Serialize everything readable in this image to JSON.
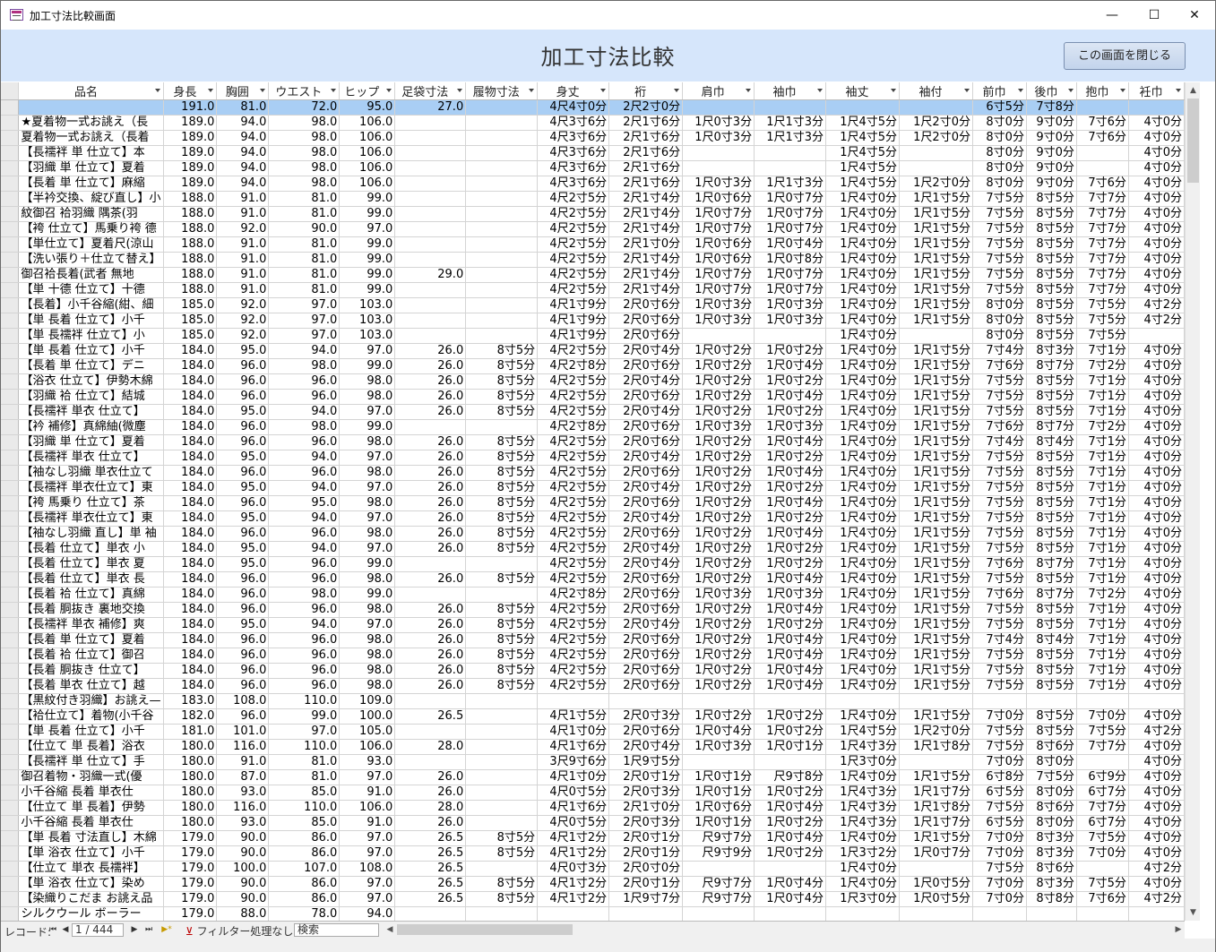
{
  "window": {
    "title": "加工寸法比較画面",
    "minimize_glyph": "—",
    "maximize_glyph": "☐",
    "close_glyph": "✕"
  },
  "header": {
    "caption": "加工寸法比較",
    "close_button_label": "この画面を閉じる"
  },
  "grid": {
    "columns": [
      "品名",
      "身長",
      "胸囲",
      "ウエスト",
      "ヒップ",
      "足袋寸法",
      "履物寸法",
      "身丈",
      "裄",
      "肩巾",
      "袖巾",
      "袖丈",
      "袖付",
      "前巾",
      "後巾",
      "抱巾",
      "衽巾"
    ],
    "sorted_column": "身長",
    "rows": [
      [
        "",
        "191.0",
        "81.0",
        "72.0",
        "95.0",
        "27.0",
        "",
        "4尺4寸0分",
        "2尺2寸0分",
        "",
        "",
        "",
        "",
        "6寸5分",
        "7寸8分",
        "",
        ""
      ],
      [
        "★夏着物一式お誂え（長",
        "189.0",
        "94.0",
        "98.0",
        "106.0",
        "",
        "",
        "4尺3寸6分",
        "2尺1寸6分",
        "1尺0寸3分",
        "1尺1寸3分",
        "1尺4寸5分",
        "1尺2寸0分",
        "8寸0分",
        "9寸0分",
        "7寸6分",
        "4寸0分"
      ],
      [
        "夏着物一式お誂え（長着",
        "189.0",
        "94.0",
        "98.0",
        "106.0",
        "",
        "",
        "4尺3寸6分",
        "2尺1寸6分",
        "1尺0寸3分",
        "1尺1寸3分",
        "1尺4寸5分",
        "1尺2寸0分",
        "8寸0分",
        "9寸0分",
        "7寸6分",
        "4寸0分"
      ],
      [
        "【長襦袢 単 仕立て】本",
        "189.0",
        "94.0",
        "98.0",
        "106.0",
        "",
        "",
        "4尺3寸6分",
        "2尺1寸6分",
        "",
        "",
        "1尺4寸5分",
        "",
        "8寸0分",
        "9寸0分",
        "",
        "4寸0分"
      ],
      [
        "【羽織 単 仕立て】夏着",
        "189.0",
        "94.0",
        "98.0",
        "106.0",
        "",
        "",
        "4尺3寸6分",
        "2尺1寸6分",
        "",
        "",
        "1尺4寸5分",
        "",
        "8寸0分",
        "9寸0分",
        "",
        "4寸0分"
      ],
      [
        "【長着 単 仕立て】麻縮",
        "189.0",
        "94.0",
        "98.0",
        "106.0",
        "",
        "",
        "4尺3寸6分",
        "2尺1寸6分",
        "1尺0寸3分",
        "1尺1寸3分",
        "1尺4寸5分",
        "1尺2寸0分",
        "8寸0分",
        "9寸0分",
        "7寸6分",
        "4寸0分"
      ],
      [
        "【半衿交換、綻び直し】小",
        "188.0",
        "91.0",
        "81.0",
        "99.0",
        "",
        "",
        "4尺2寸5分",
        "2尺1寸4分",
        "1尺0寸6分",
        "1尺0寸7分",
        "1尺4寸0分",
        "1尺1寸5分",
        "7寸5分",
        "8寸5分",
        "7寸7分",
        "4寸0分"
      ],
      [
        "紋御召 袷羽織 隅茶(羽",
        "188.0",
        "91.0",
        "81.0",
        "99.0",
        "",
        "",
        "4尺2寸5分",
        "2尺1寸4分",
        "1尺0寸7分",
        "1尺0寸7分",
        "1尺4寸0分",
        "1尺1寸5分",
        "7寸5分",
        "8寸5分",
        "7寸7分",
        "4寸0分"
      ],
      [
        "【袴 仕立て】馬乗り袴 德",
        "188.0",
        "92.0",
        "90.0",
        "97.0",
        "",
        "",
        "4尺2寸5分",
        "2尺1寸4分",
        "1尺0寸7分",
        "1尺0寸7分",
        "1尺4寸0分",
        "1尺1寸5分",
        "7寸5分",
        "8寸5分",
        "7寸7分",
        "4寸0分"
      ],
      [
        "【単仕立て】夏着尺(涼山",
        "188.0",
        "91.0",
        "81.0",
        "99.0",
        "",
        "",
        "4尺2寸5分",
        "2尺1寸0分",
        "1尺0寸6分",
        "1尺0寸4分",
        "1尺4寸0分",
        "1尺1寸5分",
        "7寸5分",
        "8寸5分",
        "7寸7分",
        "4寸0分"
      ],
      [
        "【洗い張り＋仕立て替え】",
        "188.0",
        "91.0",
        "81.0",
        "99.0",
        "",
        "",
        "4尺2寸5分",
        "2尺1寸4分",
        "1尺0寸6分",
        "1尺0寸8分",
        "1尺4寸0分",
        "1尺1寸5分",
        "7寸5分",
        "8寸5分",
        "7寸7分",
        "4寸0分"
      ],
      [
        "御召袷長着(武者 無地",
        "188.0",
        "91.0",
        "81.0",
        "99.0",
        "29.0",
        "",
        "4尺2寸5分",
        "2尺1寸4分",
        "1尺0寸7分",
        "1尺0寸7分",
        "1尺4寸0分",
        "1尺1寸5分",
        "7寸5分",
        "8寸5分",
        "7寸7分",
        "4寸0分"
      ],
      [
        "【単 十德 仕立て】十德",
        "188.0",
        "91.0",
        "81.0",
        "99.0",
        "",
        "",
        "4尺2寸5分",
        "2尺1寸4分",
        "1尺0寸7分",
        "1尺0寸7分",
        "1尺4寸0分",
        "1尺1寸5分",
        "7寸5分",
        "8寸5分",
        "7寸7分",
        "4寸0分"
      ],
      [
        "【長着】小千谷縮(紺、細",
        "185.0",
        "92.0",
        "97.0",
        "103.0",
        "",
        "",
        "4尺1寸9分",
        "2尺0寸6分",
        "1尺0寸3分",
        "1尺0寸3分",
        "1尺4寸0分",
        "1尺1寸5分",
        "8寸0分",
        "8寸5分",
        "7寸5分",
        "4寸2分"
      ],
      [
        "【単 長着 仕立て】小千",
        "185.0",
        "92.0",
        "97.0",
        "103.0",
        "",
        "",
        "4尺1寸9分",
        "2尺0寸6分",
        "1尺0寸3分",
        "1尺0寸3分",
        "1尺4寸0分",
        "1尺1寸5分",
        "8寸0分",
        "8寸5分",
        "7寸5分",
        "4寸2分"
      ],
      [
        "【単 長襦袢 仕立て】小",
        "185.0",
        "92.0",
        "97.0",
        "103.0",
        "",
        "",
        "4尺1寸9分",
        "2尺0寸6分",
        "",
        "",
        "1尺4寸0分",
        "",
        "8寸0分",
        "8寸5分",
        "7寸5分",
        ""
      ],
      [
        "【単 長着 仕立て】小千",
        "184.0",
        "95.0",
        "94.0",
        "97.0",
        "26.0",
        "8寸5分",
        "4尺2寸5分",
        "2尺0寸4分",
        "1尺0寸2分",
        "1尺0寸2分",
        "1尺4寸0分",
        "1尺1寸5分",
        "7寸4分",
        "8寸3分",
        "7寸1分",
        "4寸0分"
      ],
      [
        "【長着 単 仕立て】デニ",
        "184.0",
        "96.0",
        "98.0",
        "99.0",
        "26.0",
        "8寸5分",
        "4尺2寸8分",
        "2尺0寸6分",
        "1尺0寸2分",
        "1尺0寸4分",
        "1尺4寸0分",
        "1尺1寸5分",
        "7寸6分",
        "8寸7分",
        "7寸2分",
        "4寸0分"
      ],
      [
        "【浴衣 仕立て】伊勢木綿",
        "184.0",
        "96.0",
        "96.0",
        "98.0",
        "26.0",
        "8寸5分",
        "4尺2寸5分",
        "2尺0寸4分",
        "1尺0寸2分",
        "1尺0寸2分",
        "1尺4寸0分",
        "1尺1寸5分",
        "7寸5分",
        "8寸5分",
        "7寸1分",
        "4寸0分"
      ],
      [
        "【羽織 袷 仕立て】結城",
        "184.0",
        "96.0",
        "96.0",
        "98.0",
        "26.0",
        "8寸5分",
        "4尺2寸5分",
        "2尺0寸6分",
        "1尺0寸2分",
        "1尺0寸4分",
        "1尺4寸0分",
        "1尺1寸5分",
        "7寸5分",
        "8寸5分",
        "7寸1分",
        "4寸0分"
      ],
      [
        "【長襦袢 単衣 仕立て】",
        "184.0",
        "95.0",
        "94.0",
        "97.0",
        "26.0",
        "8寸5分",
        "4尺2寸5分",
        "2尺0寸4分",
        "1尺0寸2分",
        "1尺0寸2分",
        "1尺4寸0分",
        "1尺1寸5分",
        "7寸5分",
        "8寸5分",
        "7寸1分",
        "4寸0分"
      ],
      [
        "【衿 補修】真綿紬(微塵",
        "184.0",
        "96.0",
        "98.0",
        "99.0",
        "",
        "",
        "4尺2寸8分",
        "2尺0寸6分",
        "1尺0寸3分",
        "1尺0寸3分",
        "1尺4寸0分",
        "1尺1寸5分",
        "7寸6分",
        "8寸7分",
        "7寸2分",
        "4寸0分"
      ],
      [
        "【羽織 単 仕立て】夏着",
        "184.0",
        "96.0",
        "96.0",
        "98.0",
        "26.0",
        "8寸5分",
        "4尺2寸5分",
        "2尺0寸6分",
        "1尺0寸2分",
        "1尺0寸4分",
        "1尺4寸0分",
        "1尺1寸5分",
        "7寸4分",
        "8寸4分",
        "7寸1分",
        "4寸0分"
      ],
      [
        "【長襦袢 単衣 仕立て】",
        "184.0",
        "95.0",
        "94.0",
        "97.0",
        "26.0",
        "8寸5分",
        "4尺2寸5分",
        "2尺0寸4分",
        "1尺0寸2分",
        "1尺0寸2分",
        "1尺4寸0分",
        "1尺1寸5分",
        "7寸5分",
        "8寸5分",
        "7寸1分",
        "4寸0分"
      ],
      [
        "【袖なし羽織 単衣仕立て",
        "184.0",
        "96.0",
        "96.0",
        "98.0",
        "26.0",
        "8寸5分",
        "4尺2寸5分",
        "2尺0寸6分",
        "1尺0寸2分",
        "1尺0寸4分",
        "1尺4寸0分",
        "1尺1寸5分",
        "7寸5分",
        "8寸5分",
        "7寸1分",
        "4寸0分"
      ],
      [
        "【長襦袢 単衣仕立て】東",
        "184.0",
        "95.0",
        "94.0",
        "97.0",
        "26.0",
        "8寸5分",
        "4尺2寸5分",
        "2尺0寸4分",
        "1尺0寸2分",
        "1尺0寸2分",
        "1尺4寸0分",
        "1尺1寸5分",
        "7寸5分",
        "8寸5分",
        "7寸1分",
        "4寸0分"
      ],
      [
        "【袴 馬乗り 仕立て】茶",
        "184.0",
        "96.0",
        "95.0",
        "98.0",
        "26.0",
        "8寸5分",
        "4尺2寸5分",
        "2尺0寸6分",
        "1尺0寸2分",
        "1尺0寸4分",
        "1尺4寸0分",
        "1尺1寸5分",
        "7寸5分",
        "8寸5分",
        "7寸1分",
        "4寸0分"
      ],
      [
        "【長襦袢 単衣仕立て】東",
        "184.0",
        "95.0",
        "94.0",
        "97.0",
        "26.0",
        "8寸5分",
        "4尺2寸5分",
        "2尺0寸4分",
        "1尺0寸2分",
        "1尺0寸2分",
        "1尺4寸0分",
        "1尺1寸5分",
        "7寸5分",
        "8寸5分",
        "7寸1分",
        "4寸0分"
      ],
      [
        "【袖なし羽織 直し】単 袖",
        "184.0",
        "96.0",
        "96.0",
        "98.0",
        "26.0",
        "8寸5分",
        "4尺2寸5分",
        "2尺0寸6分",
        "1尺0寸2分",
        "1尺0寸4分",
        "1尺4寸0分",
        "1尺1寸5分",
        "7寸5分",
        "8寸5分",
        "7寸1分",
        "4寸0分"
      ],
      [
        "【長着 仕立て】単衣 小",
        "184.0",
        "95.0",
        "94.0",
        "97.0",
        "26.0",
        "8寸5分",
        "4尺2寸5分",
        "2尺0寸4分",
        "1尺0寸2分",
        "1尺0寸2分",
        "1尺4寸0分",
        "1尺1寸5分",
        "7寸5分",
        "8寸5分",
        "7寸1分",
        "4寸0分"
      ],
      [
        "【長着 仕立て】単衣 夏",
        "184.0",
        "95.0",
        "96.0",
        "99.0",
        "",
        "",
        "4尺2寸5分",
        "2尺0寸4分",
        "1尺0寸2分",
        "1尺0寸2分",
        "1尺4寸0分",
        "1尺1寸5分",
        "7寸6分",
        "8寸7分",
        "7寸1分",
        "4寸0分"
      ],
      [
        "【長着 仕立て】単衣 長",
        "184.0",
        "96.0",
        "96.0",
        "98.0",
        "26.0",
        "8寸5分",
        "4尺2寸5分",
        "2尺0寸6分",
        "1尺0寸2分",
        "1尺0寸4分",
        "1尺4寸0分",
        "1尺1寸5分",
        "7寸5分",
        "8寸5分",
        "7寸1分",
        "4寸0分"
      ],
      [
        "【長着 袷 仕立て】真綿",
        "184.0",
        "96.0",
        "98.0",
        "99.0",
        "",
        "",
        "4尺2寸8分",
        "2尺0寸6分",
        "1尺0寸3分",
        "1尺0寸3分",
        "1尺4寸0分",
        "1尺1寸5分",
        "7寸6分",
        "8寸7分",
        "7寸2分",
        "4寸0分"
      ],
      [
        "【長着 胴抜き 裏地交換",
        "184.0",
        "96.0",
        "96.0",
        "98.0",
        "26.0",
        "8寸5分",
        "4尺2寸5分",
        "2尺0寸6分",
        "1尺0寸2分",
        "1尺0寸4分",
        "1尺4寸0分",
        "1尺1寸5分",
        "7寸5分",
        "8寸5分",
        "7寸1分",
        "4寸0分"
      ],
      [
        "【長襦袢 単衣 補修】爽",
        "184.0",
        "95.0",
        "94.0",
        "97.0",
        "26.0",
        "8寸5分",
        "4尺2寸5分",
        "2尺0寸4分",
        "1尺0寸2分",
        "1尺0寸2分",
        "1尺4寸0分",
        "1尺1寸5分",
        "7寸5分",
        "8寸5分",
        "7寸1分",
        "4寸0分"
      ],
      [
        "【長着 単 仕立て】夏着",
        "184.0",
        "96.0",
        "96.0",
        "98.0",
        "26.0",
        "8寸5分",
        "4尺2寸5分",
        "2尺0寸6分",
        "1尺0寸2分",
        "1尺0寸4分",
        "1尺4寸0分",
        "1尺1寸5分",
        "7寸4分",
        "8寸4分",
        "7寸1分",
        "4寸0分"
      ],
      [
        "【長着 袷 仕立て】御召",
        "184.0",
        "96.0",
        "96.0",
        "98.0",
        "26.0",
        "8寸5分",
        "4尺2寸5分",
        "2尺0寸6分",
        "1尺0寸2分",
        "1尺0寸4分",
        "1尺4寸0分",
        "1尺1寸5分",
        "7寸5分",
        "8寸5分",
        "7寸1分",
        "4寸0分"
      ],
      [
        "【長着 胴抜き 仕立て】",
        "184.0",
        "96.0",
        "96.0",
        "98.0",
        "26.0",
        "8寸5分",
        "4尺2寸5分",
        "2尺0寸6分",
        "1尺0寸2分",
        "1尺0寸4分",
        "1尺4寸0分",
        "1尺1寸5分",
        "7寸5分",
        "8寸5分",
        "7寸1分",
        "4寸0分"
      ],
      [
        "【長着 単衣 仕立て】越",
        "184.0",
        "96.0",
        "96.0",
        "98.0",
        "26.0",
        "8寸5分",
        "4尺2寸5分",
        "2尺0寸6分",
        "1尺0寸2分",
        "1尺0寸4分",
        "1尺4寸0分",
        "1尺1寸5分",
        "7寸5分",
        "8寸5分",
        "7寸1分",
        "4寸0分"
      ],
      [
        "【黒紋付き羽織】お誂え—",
        "183.0",
        "108.0",
        "110.0",
        "109.0",
        "",
        "",
        "",
        "",
        "",
        "",
        "",
        "",
        "",
        "",
        "",
        ""
      ],
      [
        "【袷仕立て】着物(小千谷",
        "182.0",
        "96.0",
        "99.0",
        "100.0",
        "26.5",
        "",
        "4尺1寸5分",
        "2尺0寸3分",
        "1尺0寸2分",
        "1尺0寸2分",
        "1尺4寸0分",
        "1尺1寸5分",
        "7寸0分",
        "8寸5分",
        "7寸0分",
        "4寸0分"
      ],
      [
        "【単 長着 仕立て】小千",
        "181.0",
        "101.0",
        "97.0",
        "105.0",
        "",
        "",
        "4尺1寸0分",
        "2尺0寸6分",
        "1尺0寸4分",
        "1尺0寸2分",
        "1尺4寸5分",
        "1尺2寸0分",
        "7寸5分",
        "8寸5分",
        "7寸5分",
        "4寸2分"
      ],
      [
        "【仕立て 単 長着】浴衣",
        "180.0",
        "116.0",
        "110.0",
        "106.0",
        "28.0",
        "",
        "4尺1寸6分",
        "2尺0寸4分",
        "1尺0寸3分",
        "1尺0寸1分",
        "1尺4寸3分",
        "1尺1寸8分",
        "7寸5分",
        "8寸6分",
        "7寸7分",
        "4寸0分"
      ],
      [
        "【長襦袢 単 仕立て】手",
        "180.0",
        "91.0",
        "81.0",
        "93.0",
        "",
        "",
        "3尺9寸6分",
        "1尺9寸5分",
        "",
        "",
        "1尺3寸0分",
        "",
        "7寸0分",
        "8寸0分",
        "",
        "4寸0分"
      ],
      [
        "御召着物・羽織一式(優",
        "180.0",
        "87.0",
        "81.0",
        "97.0",
        "26.0",
        "",
        "4尺1寸0分",
        "2尺0寸1分",
        "1尺0寸1分",
        "尺9寸8分",
        "1尺4寸0分",
        "1尺1寸5分",
        "6寸8分",
        "7寸5分",
        "6寸9分",
        "4寸0分"
      ],
      [
        "小千谷縮 長着 単衣仕",
        "180.0",
        "93.0",
        "85.0",
        "91.0",
        "26.0",
        "",
        "4尺0寸5分",
        "2尺0寸3分",
        "1尺0寸1分",
        "1尺0寸2分",
        "1尺4寸3分",
        "1尺1寸7分",
        "6寸5分",
        "8寸0分",
        "6寸7分",
        "4寸0分"
      ],
      [
        "【仕立て 単 長着】伊勢",
        "180.0",
        "116.0",
        "110.0",
        "106.0",
        "28.0",
        "",
        "4尺1寸6分",
        "2尺1寸0分",
        "1尺0寸6分",
        "1尺0寸4分",
        "1尺4寸3分",
        "1尺1寸8分",
        "7寸5分",
        "8寸6分",
        "7寸7分",
        "4寸0分"
      ],
      [
        "小千谷縮 長着 単衣仕",
        "180.0",
        "93.0",
        "85.0",
        "91.0",
        "26.0",
        "",
        "4尺0寸5分",
        "2尺0寸3分",
        "1尺0寸1分",
        "1尺0寸2分",
        "1尺4寸3分",
        "1尺1寸7分",
        "6寸5分",
        "8寸0分",
        "6寸7分",
        "4寸0分"
      ],
      [
        "【単 長着 寸法直し】木綿",
        "179.0",
        "90.0",
        "86.0",
        "97.0",
        "26.5",
        "8寸5分",
        "4尺1寸2分",
        "2尺0寸1分",
        "尺9寸7分",
        "1尺0寸4分",
        "1尺4寸0分",
        "1尺1寸5分",
        "7寸0分",
        "8寸3分",
        "7寸5分",
        "4寸0分"
      ],
      [
        "【単 浴衣 仕立て】小千",
        "179.0",
        "90.0",
        "86.0",
        "97.0",
        "26.5",
        "8寸5分",
        "4尺1寸2分",
        "2尺0寸1分",
        "尺9寸9分",
        "1尺0寸2分",
        "1尺3寸2分",
        "1尺0寸7分",
        "7寸0分",
        "8寸3分",
        "7寸0分",
        "4寸0分"
      ],
      [
        "【仕立て 単衣 長襦袢】",
        "179.0",
        "100.0",
        "107.0",
        "108.0",
        "26.5",
        "",
        "4尺0寸3分",
        "2尺0寸0分",
        "",
        "",
        "1尺4寸0分",
        "",
        "7寸5分",
        "8寸6分",
        "",
        "4寸2分"
      ],
      [
        "【単 浴衣 仕立て】染め",
        "179.0",
        "90.0",
        "86.0",
        "97.0",
        "26.5",
        "8寸5分",
        "4尺1寸2分",
        "2尺0寸1分",
        "尺9寸7分",
        "1尺0寸4分",
        "1尺4寸0分",
        "1尺0寸5分",
        "7寸0分",
        "8寸3分",
        "7寸5分",
        "4寸0分"
      ],
      [
        "【染織りこだま お誂え品",
        "179.0",
        "90.0",
        "86.0",
        "97.0",
        "26.5",
        "8寸5分",
        "4尺1寸2分",
        "1尺9寸7分",
        "尺9寸7分",
        "1尺0寸4分",
        "1尺3寸0分",
        "1尺0寸5分",
        "7寸0分",
        "8寸8分",
        "7寸6分",
        "4寸2分"
      ],
      [
        "シルクウール ボーラー",
        "179.0",
        "88.0",
        "78.0",
        "94.0",
        "",
        "",
        "",
        "",
        "",
        "",
        "",
        "",
        "",
        "",
        "",
        ""
      ]
    ]
  },
  "navbar": {
    "record_label": "レコード:",
    "first_glyph": "⏮",
    "prev_glyph": "◀",
    "current": "1 / 444",
    "next_glyph": "▶",
    "last_glyph": "⏭",
    "new_glyph": "▶*",
    "filter_label": "フィルター処理なし",
    "search_label": "検索"
  }
}
